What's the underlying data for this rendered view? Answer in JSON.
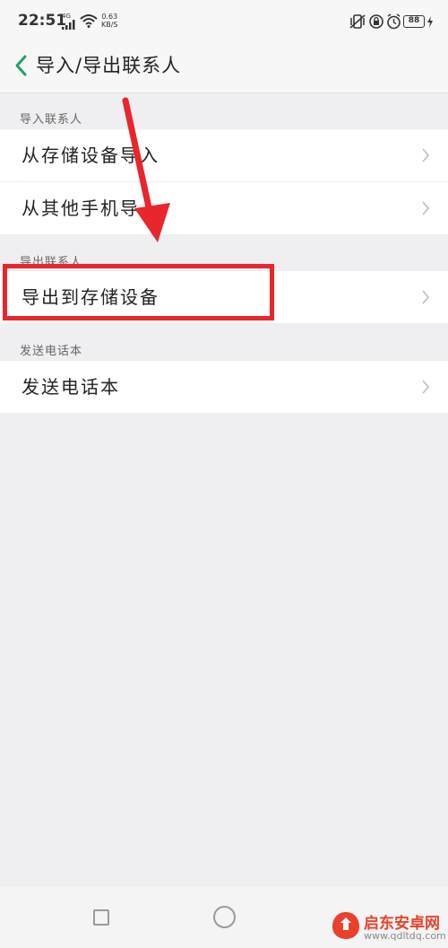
{
  "status_bar": {
    "time": "22:51",
    "network_type": "4G",
    "speed_value": "0.63",
    "speed_unit": "KB/S",
    "battery": "88"
  },
  "header": {
    "title": "导入/导出联系人"
  },
  "sections": {
    "import": {
      "label": "导入联系人",
      "items": [
        {
          "label": "从存储设备导入"
        },
        {
          "label": "从其他手机导入"
        }
      ]
    },
    "export": {
      "label": "导出联系人",
      "items": [
        {
          "label": "导出到存储设备"
        }
      ]
    },
    "send": {
      "label": "发送电话本",
      "items": [
        {
          "label": "发送电话本"
        }
      ]
    }
  },
  "annotation": {
    "color": "#e8262c"
  },
  "watermark": {
    "text": "启东安卓网",
    "url": "www.qdltdq.com"
  }
}
